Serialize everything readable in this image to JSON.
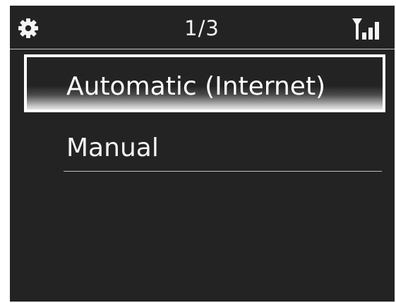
{
  "header": {
    "settings_icon": "gear-icon",
    "page_indicator": "1/3",
    "signal_icon": "signal-strength-icon"
  },
  "menu": {
    "items": [
      {
        "label": "Automatic (Internet)",
        "selected": true
      },
      {
        "label": "Manual",
        "selected": false
      }
    ]
  },
  "colors": {
    "background": "#232323",
    "text": "#f4f4f4",
    "highlight_border": "#ffffff"
  }
}
